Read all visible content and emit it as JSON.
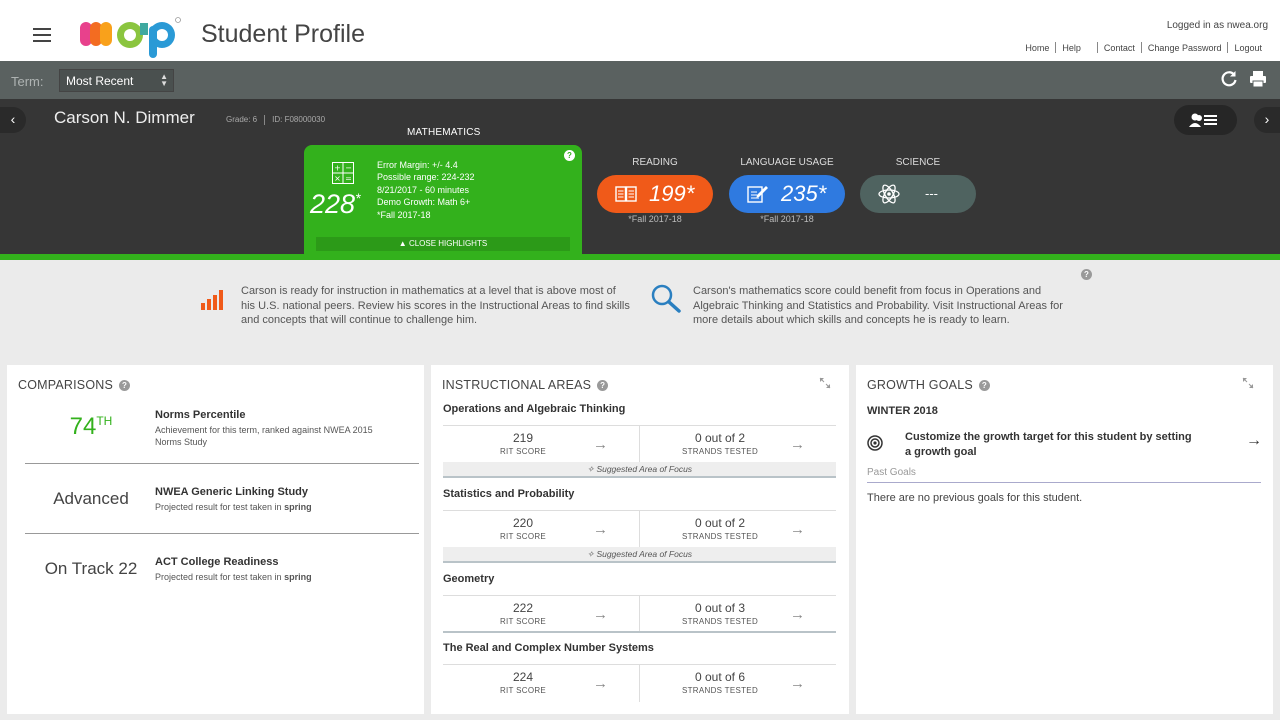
{
  "header": {
    "app_title": "Student Profile",
    "logged_in": "Logged in as nwea.org",
    "links": [
      "Home",
      "Help",
      "Contact",
      "Change Password",
      "Logout"
    ]
  },
  "termbar": {
    "label": "Term:",
    "selected": "Most Recent",
    "icons": [
      "refresh-icon",
      "print-icon"
    ]
  },
  "student": {
    "name": "Carson N. Dimmer",
    "grade": "Grade: 6",
    "id": "ID: F08000030"
  },
  "math": {
    "title": "MATHEMATICS",
    "score": "228",
    "score_mark": "*",
    "details": [
      "Error Margin: +/- 4.4",
      "Possible range: 224-232",
      "8/21/2017 - 60 minutes",
      "Demo Growth: Math 6+",
      "*Fall 2017-18"
    ],
    "close_label": "▲ CLOSE HIGHLIGHTS",
    "color": "#33b11c"
  },
  "subjects": [
    {
      "title": "READING",
      "score": "199*",
      "foot": "*Fall 2017-18",
      "color": "#f05a19",
      "icon": "book-icon"
    },
    {
      "title": "LANGUAGE USAGE",
      "score": "235*",
      "foot": "*Fall 2017-18",
      "color": "#2f7ae0",
      "icon": "pencil-icon"
    },
    {
      "title": "SCIENCE",
      "score": "---",
      "foot": "",
      "color": "#4f6360",
      "icon": "atom-icon"
    }
  ],
  "highlights": {
    "left": "Carson is ready for instruction in mathematics at a level that is above most of his U.S. national peers. Review his scores in the Instructional Areas to find skills and concepts that will continue to challenge him.",
    "right": "Carson's mathematics score could benefit from focus in Operations and Algebraic Thinking and Statistics and Probability. Visit Instructional Areas for more details about which skills and concepts he is ready to learn."
  },
  "comparisons": {
    "title": "COMPARISONS",
    "rows": [
      {
        "value": "74",
        "suffix": "TH",
        "label": "Norms Percentile",
        "desc": "Achievement for this term, ranked against NWEA 2015 Norms Study",
        "color": "#33b11c"
      },
      {
        "value": "Advanced",
        "label": "NWEA Generic Linking Study",
        "desc": "Projected result for test taken in",
        "desc_bold": "spring"
      },
      {
        "value": "On Track 22",
        "label": "ACT College Readiness",
        "desc": "Projected result for test taken in",
        "desc_bold": "spring"
      }
    ]
  },
  "instructional": {
    "title": "INSTRUCTIONAL AREAS",
    "rit_caption": "RIT SCORE",
    "strand_caption": "STRANDS TESTED",
    "focus_label": "Suggested Area of Focus",
    "areas": [
      {
        "name": "Operations and Algebraic Thinking",
        "rit": "219",
        "strands": "0 out of 2",
        "focus": true
      },
      {
        "name": "Statistics and Probability",
        "rit": "220",
        "strands": "0 out of 2",
        "focus": true
      },
      {
        "name": "Geometry",
        "rit": "222",
        "strands": "0 out of 3",
        "focus": false
      },
      {
        "name": "The Real and Complex Number Systems",
        "rit": "224",
        "strands": "0 out of 6",
        "focus": false
      }
    ]
  },
  "growth": {
    "title": "GROWTH GOALS",
    "term": "WINTER 2018",
    "target_text": "Customize the growth target for this student by setting a growth goal",
    "past_label": "Past Goals",
    "none_text": "There are no previous goals for this student."
  }
}
